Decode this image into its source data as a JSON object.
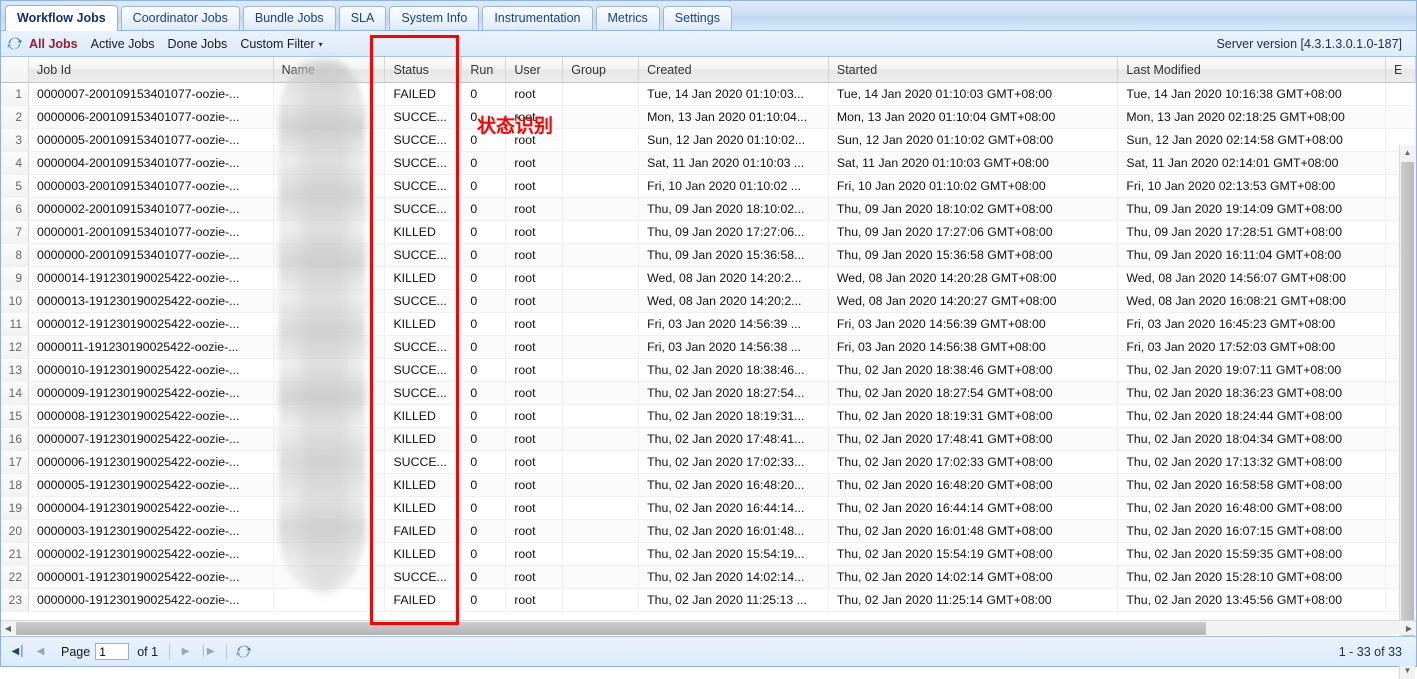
{
  "tabs": [
    {
      "label": "Workflow Jobs",
      "active": true
    },
    {
      "label": "Coordinator Jobs",
      "active": false
    },
    {
      "label": "Bundle Jobs",
      "active": false
    },
    {
      "label": "SLA",
      "active": false
    },
    {
      "label": "System Info",
      "active": false
    },
    {
      "label": "Instrumentation",
      "active": false
    },
    {
      "label": "Metrics",
      "active": false
    },
    {
      "label": "Settings",
      "active": false
    }
  ],
  "toolbar": {
    "refresh_icon": "refresh-icon",
    "filters": [
      {
        "label": "All Jobs",
        "selected": true
      },
      {
        "label": "Active Jobs",
        "selected": false
      },
      {
        "label": "Done Jobs",
        "selected": false
      },
      {
        "label": "Custom Filter",
        "selected": false,
        "caret": "▾"
      }
    ],
    "server_version": "Server version [4.3.1.3.0.1.0-187]"
  },
  "annotation": {
    "text": "状态识别",
    "color": "#ff0000",
    "highlight_column": "Status"
  },
  "grid": {
    "columns": [
      {
        "key": "job_id",
        "label": "Job Id"
      },
      {
        "key": "name",
        "label": "Name"
      },
      {
        "key": "status",
        "label": "Status"
      },
      {
        "key": "run",
        "label": "Run"
      },
      {
        "key": "user",
        "label": "User"
      },
      {
        "key": "group",
        "label": "Group"
      },
      {
        "key": "created",
        "label": "Created"
      },
      {
        "key": "started",
        "label": "Started"
      },
      {
        "key": "last_modified",
        "label": "Last Modified"
      },
      {
        "key": "ended",
        "label": "E"
      }
    ],
    "rows": [
      {
        "n": "1",
        "job_id": "0000007-200109153401077-oozie-...",
        "name": "",
        "status": "FAILED",
        "run": "0",
        "user": "root",
        "group": "",
        "created": "Tue, 14 Jan 2020 01:10:03...",
        "started": "Tue, 14 Jan 2020 01:10:03 GMT+08:00",
        "last_modified": "Tue, 14 Jan 2020 10:16:38 GMT+08:00",
        "ended": ""
      },
      {
        "n": "2",
        "job_id": "0000006-200109153401077-oozie-...",
        "name": "",
        "status": "SUCCE...",
        "run": "0",
        "user": "root",
        "group": "",
        "created": "Mon, 13 Jan 2020 01:10:04...",
        "started": "Mon, 13 Jan 2020 01:10:04 GMT+08:00",
        "last_modified": "Mon, 13 Jan 2020 02:18:25 GMT+08:00",
        "ended": ""
      },
      {
        "n": "3",
        "job_id": "0000005-200109153401077-oozie-...",
        "name": "",
        "status": "SUCCE...",
        "run": "0",
        "user": "root",
        "group": "",
        "created": "Sun, 12 Jan 2020 01:10:02...",
        "started": "Sun, 12 Jan 2020 01:10:02 GMT+08:00",
        "last_modified": "Sun, 12 Jan 2020 02:14:58 GMT+08:00",
        "ended": ""
      },
      {
        "n": "4",
        "job_id": "0000004-200109153401077-oozie-...",
        "name": "",
        "status": "SUCCE...",
        "run": "0",
        "user": "root",
        "group": "",
        "created": "Sat, 11 Jan 2020 01:10:03 ...",
        "started": "Sat, 11 Jan 2020 01:10:03 GMT+08:00",
        "last_modified": "Sat, 11 Jan 2020 02:14:01 GMT+08:00",
        "ended": ""
      },
      {
        "n": "5",
        "job_id": "0000003-200109153401077-oozie-...",
        "name": "",
        "status": "SUCCE...",
        "run": "0",
        "user": "root",
        "group": "",
        "created": "Fri, 10 Jan 2020 01:10:02 ...",
        "started": "Fri, 10 Jan 2020 01:10:02 GMT+08:00",
        "last_modified": "Fri, 10 Jan 2020 02:13:53 GMT+08:00",
        "ended": ""
      },
      {
        "n": "6",
        "job_id": "0000002-200109153401077-oozie-...",
        "name": "",
        "status": "SUCCE...",
        "run": "0",
        "user": "root",
        "group": "",
        "created": "Thu, 09 Jan 2020 18:10:02...",
        "started": "Thu, 09 Jan 2020 18:10:02 GMT+08:00",
        "last_modified": "Thu, 09 Jan 2020 19:14:09 GMT+08:00",
        "ended": ""
      },
      {
        "n": "7",
        "job_id": "0000001-200109153401077-oozie-...",
        "name": "",
        "status": "KILLED",
        "run": "0",
        "user": "root",
        "group": "",
        "created": "Thu, 09 Jan 2020 17:27:06...",
        "started": "Thu, 09 Jan 2020 17:27:06 GMT+08:00",
        "last_modified": "Thu, 09 Jan 2020 17:28:51 GMT+08:00",
        "ended": ""
      },
      {
        "n": "8",
        "job_id": "0000000-200109153401077-oozie-...",
        "name": "",
        "status": "SUCCE...",
        "run": "0",
        "user": "root",
        "group": "",
        "created": "Thu, 09 Jan 2020 15:36:58...",
        "started": "Thu, 09 Jan 2020 15:36:58 GMT+08:00",
        "last_modified": "Thu, 09 Jan 2020 16:11:04 GMT+08:00",
        "ended": ""
      },
      {
        "n": "9",
        "job_id": "0000014-191230190025422-oozie-...",
        "name": "",
        "status": "KILLED",
        "run": "0",
        "user": "root",
        "group": "",
        "created": "Wed, 08 Jan 2020 14:20:2...",
        "started": "Wed, 08 Jan 2020 14:20:28 GMT+08:00",
        "last_modified": "Wed, 08 Jan 2020 14:56:07 GMT+08:00",
        "ended": ""
      },
      {
        "n": "10",
        "job_id": "0000013-191230190025422-oozie-...",
        "name": "",
        "status": "SUCCE...",
        "run": "0",
        "user": "root",
        "group": "",
        "created": "Wed, 08 Jan 2020 14:20:2...",
        "started": "Wed, 08 Jan 2020 14:20:27 GMT+08:00",
        "last_modified": "Wed, 08 Jan 2020 16:08:21 GMT+08:00",
        "ended": ""
      },
      {
        "n": "11",
        "job_id": "0000012-191230190025422-oozie-...",
        "name": "",
        "status": "KILLED",
        "run": "0",
        "user": "root",
        "group": "",
        "created": "Fri, 03 Jan 2020 14:56:39 ...",
        "started": "Fri, 03 Jan 2020 14:56:39 GMT+08:00",
        "last_modified": "Fri, 03 Jan 2020 16:45:23 GMT+08:00",
        "ended": ""
      },
      {
        "n": "12",
        "job_id": "0000011-191230190025422-oozie-...",
        "name": "",
        "status": "SUCCE...",
        "run": "0",
        "user": "root",
        "group": "",
        "created": "Fri, 03 Jan 2020 14:56:38 ...",
        "started": "Fri, 03 Jan 2020 14:56:38 GMT+08:00",
        "last_modified": "Fri, 03 Jan 2020 17:52:03 GMT+08:00",
        "ended": ""
      },
      {
        "n": "13",
        "job_id": "0000010-191230190025422-oozie-...",
        "name": "",
        "status": "SUCCE...",
        "run": "0",
        "user": "root",
        "group": "",
        "created": "Thu, 02 Jan 2020 18:38:46...",
        "started": "Thu, 02 Jan 2020 18:38:46 GMT+08:00",
        "last_modified": "Thu, 02 Jan 2020 19:07:11 GMT+08:00",
        "ended": ""
      },
      {
        "n": "14",
        "job_id": "0000009-191230190025422-oozie-...",
        "name": "",
        "status": "SUCCE...",
        "run": "0",
        "user": "root",
        "group": "",
        "created": "Thu, 02 Jan 2020 18:27:54...",
        "started": "Thu, 02 Jan 2020 18:27:54 GMT+08:00",
        "last_modified": "Thu, 02 Jan 2020 18:36:23 GMT+08:00",
        "ended": ""
      },
      {
        "n": "15",
        "job_id": "0000008-191230190025422-oozie-...",
        "name": "",
        "status": "KILLED",
        "run": "0",
        "user": "root",
        "group": "",
        "created": "Thu, 02 Jan 2020 18:19:31...",
        "started": "Thu, 02 Jan 2020 18:19:31 GMT+08:00",
        "last_modified": "Thu, 02 Jan 2020 18:24:44 GMT+08:00",
        "ended": ""
      },
      {
        "n": "16",
        "job_id": "0000007-191230190025422-oozie-...",
        "name": "",
        "status": "KILLED",
        "run": "0",
        "user": "root",
        "group": "",
        "created": "Thu, 02 Jan 2020 17:48:41...",
        "started": "Thu, 02 Jan 2020 17:48:41 GMT+08:00",
        "last_modified": "Thu, 02 Jan 2020 18:04:34 GMT+08:00",
        "ended": ""
      },
      {
        "n": "17",
        "job_id": "0000006-191230190025422-oozie-...",
        "name": "",
        "status": "SUCCE...",
        "run": "0",
        "user": "root",
        "group": "",
        "created": "Thu, 02 Jan 2020 17:02:33...",
        "started": "Thu, 02 Jan 2020 17:02:33 GMT+08:00",
        "last_modified": "Thu, 02 Jan 2020 17:13:32 GMT+08:00",
        "ended": ""
      },
      {
        "n": "18",
        "job_id": "0000005-191230190025422-oozie-...",
        "name": "",
        "status": "KILLED",
        "run": "0",
        "user": "root",
        "group": "",
        "created": "Thu, 02 Jan 2020 16:48:20...",
        "started": "Thu, 02 Jan 2020 16:48:20 GMT+08:00",
        "last_modified": "Thu, 02 Jan 2020 16:58:58 GMT+08:00",
        "ended": ""
      },
      {
        "n": "19",
        "job_id": "0000004-191230190025422-oozie-...",
        "name": "",
        "status": "KILLED",
        "run": "0",
        "user": "root",
        "group": "",
        "created": "Thu, 02 Jan 2020 16:44:14...",
        "started": "Thu, 02 Jan 2020 16:44:14 GMT+08:00",
        "last_modified": "Thu, 02 Jan 2020 16:48:00 GMT+08:00",
        "ended": ""
      },
      {
        "n": "20",
        "job_id": "0000003-191230190025422-oozie-...",
        "name": "",
        "status": "FAILED",
        "run": "0",
        "user": "root",
        "group": "",
        "created": "Thu, 02 Jan 2020 16:01:48...",
        "started": "Thu, 02 Jan 2020 16:01:48 GMT+08:00",
        "last_modified": "Thu, 02 Jan 2020 16:07:15 GMT+08:00",
        "ended": ""
      },
      {
        "n": "21",
        "job_id": "0000002-191230190025422-oozie-...",
        "name": "",
        "status": "KILLED",
        "run": "0",
        "user": "root",
        "group": "",
        "created": "Thu, 02 Jan 2020 15:54:19...",
        "started": "Thu, 02 Jan 2020 15:54:19 GMT+08:00",
        "last_modified": "Thu, 02 Jan 2020 15:59:35 GMT+08:00",
        "ended": ""
      },
      {
        "n": "22",
        "job_id": "0000001-191230190025422-oozie-...",
        "name": "",
        "status": "SUCCE...",
        "run": "0",
        "user": "root",
        "group": "",
        "created": "Thu, 02 Jan 2020 14:02:14...",
        "started": "Thu, 02 Jan 2020 14:02:14 GMT+08:00",
        "last_modified": "Thu, 02 Jan 2020 15:28:10 GMT+08:00",
        "ended": ""
      },
      {
        "n": "23",
        "job_id": "0000000-191230190025422-oozie-...",
        "name": "",
        "status": "FAILED",
        "run": "0",
        "user": "root",
        "group": "",
        "created": "Thu, 02 Jan 2020 11:25:13 ...",
        "started": "Thu, 02 Jan 2020 11:25:14 GMT+08:00",
        "last_modified": "Thu, 02 Jan 2020 13:45:56 GMT+08:00",
        "ended": ""
      }
    ]
  },
  "pager": {
    "first_icon": "◀│",
    "prev_icon": "◀",
    "next_icon": "▶",
    "last_icon": "│▶",
    "refresh_icon": "refresh-icon",
    "page_label": "Page",
    "page_value": "1",
    "of_label": "of 1",
    "range_text": "1 - 33 of 33"
  }
}
